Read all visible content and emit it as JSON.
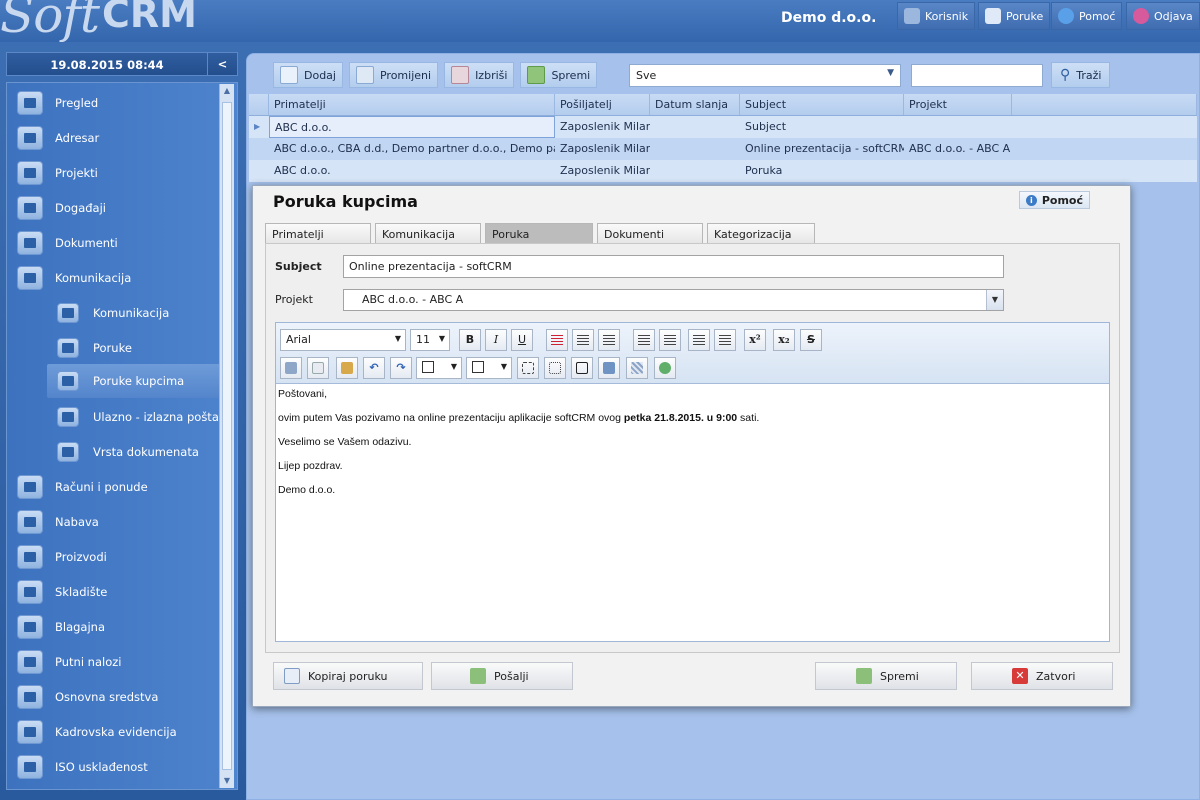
{
  "app": {
    "logo_soft": "Soft",
    "logo_crm": "CRM",
    "company": "Demo d.o.o."
  },
  "topnav": [
    {
      "label": "Korisnik",
      "icon": "user-icon"
    },
    {
      "label": "Poruke",
      "icon": "envelope-icon"
    },
    {
      "label": "Pomoć",
      "icon": "info-icon"
    },
    {
      "label": "Odjava",
      "icon": "power-icon"
    }
  ],
  "sidebar": {
    "datetime": "19.08.2015 08:44",
    "collapse": "<",
    "items": [
      {
        "label": "Pregled",
        "icon": "overview-icon"
      },
      {
        "label": "Adresar",
        "icon": "address-book-icon"
      },
      {
        "label": "Projekti",
        "icon": "projects-icon"
      },
      {
        "label": "Događaji",
        "icon": "calendar-icon"
      },
      {
        "label": "Dokumenti",
        "icon": "documents-icon"
      },
      {
        "label": "Komunikacija",
        "icon": "communication-icon"
      },
      {
        "label": "Komunikacija",
        "icon": "communication-sub-icon"
      },
      {
        "label": "Poruke",
        "icon": "messages-icon"
      },
      {
        "label": "Poruke kupcima",
        "icon": "customer-messages-icon"
      },
      {
        "label": "Ulazno - izlazna pošta",
        "icon": "mail-log-icon"
      },
      {
        "label": "Vrsta dokumenata",
        "icon": "document-types-icon"
      },
      {
        "label": "Računi i ponude",
        "icon": "invoices-icon"
      },
      {
        "label": "Nabava",
        "icon": "procurement-icon"
      },
      {
        "label": "Proizvodi",
        "icon": "products-icon"
      },
      {
        "label": "Skladište",
        "icon": "warehouse-icon"
      },
      {
        "label": "Blagajna",
        "icon": "cash-register-icon"
      },
      {
        "label": "Putni nalozi",
        "icon": "travel-orders-icon"
      },
      {
        "label": "Osnovna sredstva",
        "icon": "fixed-assets-icon"
      },
      {
        "label": "Kadrovska evidencija",
        "icon": "hr-records-icon"
      },
      {
        "label": "ISO usklađenost",
        "icon": "iso-compliance-icon"
      }
    ]
  },
  "toolbar": {
    "add": "Dodaj",
    "edit": "Promijeni",
    "delete": "Izbriši",
    "save": "Spremi",
    "filter_value": "Sve",
    "search_value": "",
    "search_button": "Traži"
  },
  "grid": {
    "columns": [
      "Primatelji",
      "Pošiljatelj",
      "Datum slanja",
      "Subject",
      "Projekt"
    ],
    "rows": [
      [
        "ABC d.o.o.",
        "Zaposlenik Milan",
        "",
        "Subject",
        ""
      ],
      [
        "ABC d.o.o., CBA d.d., Demo partner d.o.o., Demo partner",
        "Zaposlenik Milan",
        "",
        "Online prezentacija - softCRM",
        "ABC d.o.o. - ABC A"
      ],
      [
        "ABC d.o.o.",
        "Zaposlenik Milan",
        "",
        "Poruka",
        ""
      ]
    ]
  },
  "modal": {
    "title": "Poruka kupcima",
    "help": "Pomoć",
    "tabs": [
      "Primatelji",
      "Komunikacija",
      "Poruka",
      "Dokumenti",
      "Kategorizacija"
    ],
    "active_tab": "Poruka",
    "subject_label": "Subject",
    "subject_value": "Online prezentacija - softCRM",
    "project_label": "Projekt",
    "project_value": "ABC d.o.o. - ABC A",
    "editor": {
      "font": "Arial",
      "size": "11",
      "lines": {
        "l1": "Poštovani,",
        "l2a": "ovim putem Vas pozivamo na online prezentaciju aplikacije softCRM ovog ",
        "l2b": "petka 21.8.2015. u 9:00",
        "l2c": " sati.",
        "l3": "Veselimo se Vašem odazivu.",
        "l4": "Lijep pozdrav.",
        "l5": "Demo d.o.o."
      }
    },
    "buttons": {
      "copy": "Kopiraj poruku",
      "send": "Pošalji",
      "save": "Spremi",
      "close": "Zatvori"
    }
  },
  "colors": {
    "accent": "#3d72bf",
    "panel": "#a6c2ec",
    "close_red": "#d83a3a"
  }
}
